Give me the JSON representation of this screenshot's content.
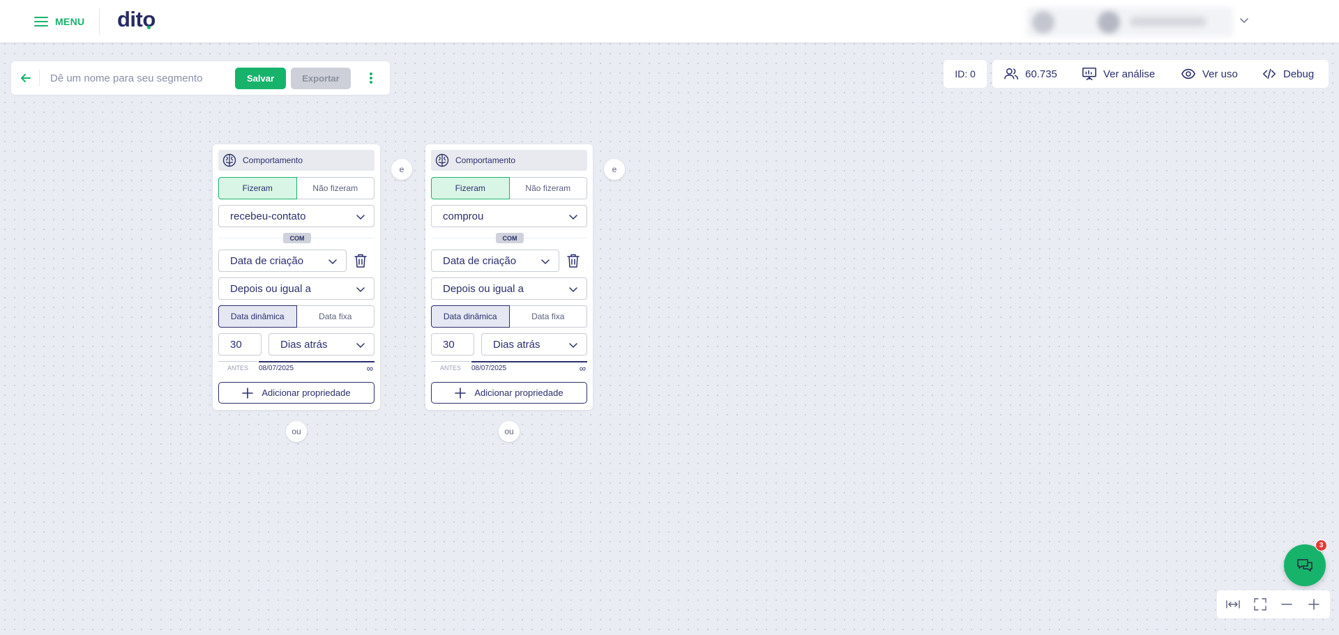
{
  "header": {
    "menu_label": "MENU",
    "logo_text": "dito"
  },
  "segment_bar": {
    "name_placeholder": "Dê um nome para seu segmento",
    "name_value": "",
    "save_label": "Salvar",
    "export_label": "Exportar"
  },
  "toolbar": {
    "id_label": "ID: 0",
    "audience_count": "60.735",
    "view_analysis": "Ver análise",
    "view_usage": "Ver uso",
    "debug": "Debug"
  },
  "cards": [
    {
      "header": "Comportamento",
      "toggle": [
        "Fizeram",
        "Não fizeram"
      ],
      "event": "recebeu-contato",
      "com_label": "COM",
      "property": "Data de criação",
      "operator": "Depois ou igual a",
      "date_toggle": [
        "Data dinâmica",
        "Data fixa"
      ],
      "amount": "30",
      "unit": "Dias atrás",
      "antes_label": "ANTES",
      "date_start": "08/07/2025",
      "date_end": "∞",
      "add_property": "Adicionar propriedade",
      "or_label": "ou",
      "and_label": "e"
    },
    {
      "header": "Comportamento",
      "toggle": [
        "Fizeram",
        "Não fizeram"
      ],
      "event": "comprou",
      "com_label": "COM",
      "property": "Data de criação",
      "operator": "Depois ou igual a",
      "date_toggle": [
        "Data dinâmica",
        "Data fixa"
      ],
      "amount": "30",
      "unit": "Dias atrás",
      "antes_label": "ANTES",
      "date_start": "08/07/2025",
      "date_end": "∞",
      "add_property": "Adicionar propriedade",
      "or_label": "ou",
      "and_label": "e"
    }
  ],
  "chat": {
    "badge_count": "3"
  },
  "colors": {
    "brand_green": "#18b36b",
    "navy": "#2a2f6b",
    "canvas_bg": "#e9ecf3",
    "badge_red": "#e53935"
  },
  "icons": {
    "menu": "hamburger-icon",
    "back": "arrow-left-icon",
    "more": "kebab-icon",
    "audience": "users-icon",
    "analysis": "presentation-chart-icon",
    "usage": "eye-icon",
    "debug": "code-icon",
    "behavior": "brain-icon",
    "delete": "trash-icon",
    "add": "plus-icon",
    "chat": "chat-icon",
    "fit": "fit-width-icon",
    "fullscreen": "fullscreen-icon",
    "zoom_out": "minus-icon",
    "zoom_in": "plus-icon"
  }
}
